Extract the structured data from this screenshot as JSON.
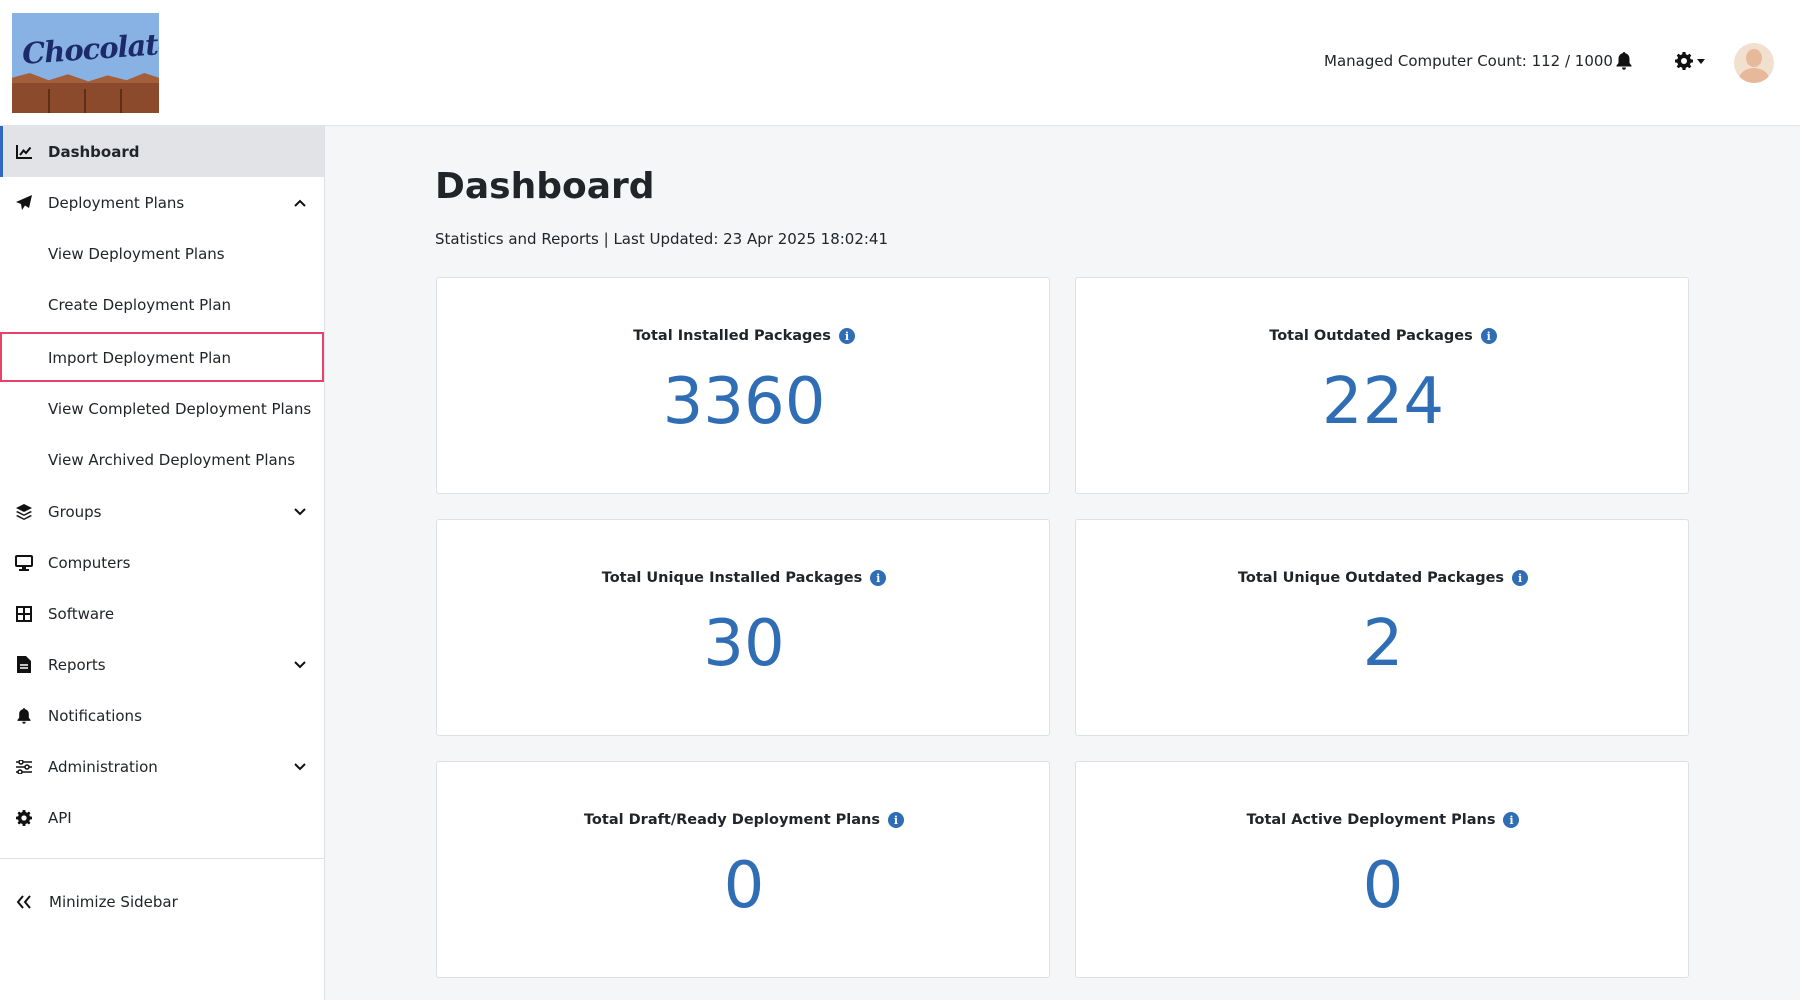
{
  "header": {
    "logo_text": "Chocolatey",
    "managed_count_label": "Managed Computer Count: 112 / 1000",
    "icons": [
      "bell-icon",
      "gear-icon",
      "caret-down-icon",
      "avatar"
    ]
  },
  "sidebar": {
    "items": [
      {
        "label": "Dashboard",
        "icon": "chart-line-icon"
      },
      {
        "label": "Deployment Plans",
        "icon": "paper-plane-icon"
      },
      {
        "label": "View Deployment Plans"
      },
      {
        "label": "Create Deployment Plan"
      },
      {
        "label": "Import Deployment Plan"
      },
      {
        "label": "View Completed Deployment Plans"
      },
      {
        "label": "View Archived Deployment Plans"
      },
      {
        "label": "Groups",
        "icon": "layers-icon"
      },
      {
        "label": "Computers",
        "icon": "desktop-icon"
      },
      {
        "label": "Software",
        "icon": "grid-icon"
      },
      {
        "label": "Reports",
        "icon": "file-icon"
      },
      {
        "label": "Notifications",
        "icon": "bell-icon"
      },
      {
        "label": "Administration",
        "icon": "sliders-icon"
      },
      {
        "label": "API",
        "icon": "cog-icon"
      }
    ],
    "minimize_label": "Minimize Sidebar"
  },
  "main": {
    "title": "Dashboard",
    "subtitle": "Statistics and Reports | Last Updated: 23 Apr 2025 18:02:41",
    "cards": [
      {
        "title": "Total Installed Packages",
        "value": "3360"
      },
      {
        "title": "Total Outdated Packages",
        "value": "224"
      },
      {
        "title": "Total Unique Installed Packages",
        "value": "30"
      },
      {
        "title": "Total Unique Outdated Packages",
        "value": "2"
      },
      {
        "title": "Total Draft/Ready Deployment Plans",
        "value": "0"
      },
      {
        "title": "Total Active Deployment Plans",
        "value": "0"
      }
    ]
  },
  "colors": {
    "accent": "#2f6db5",
    "highlight": "#e8426b",
    "active_bg": "#e1e3e6"
  }
}
